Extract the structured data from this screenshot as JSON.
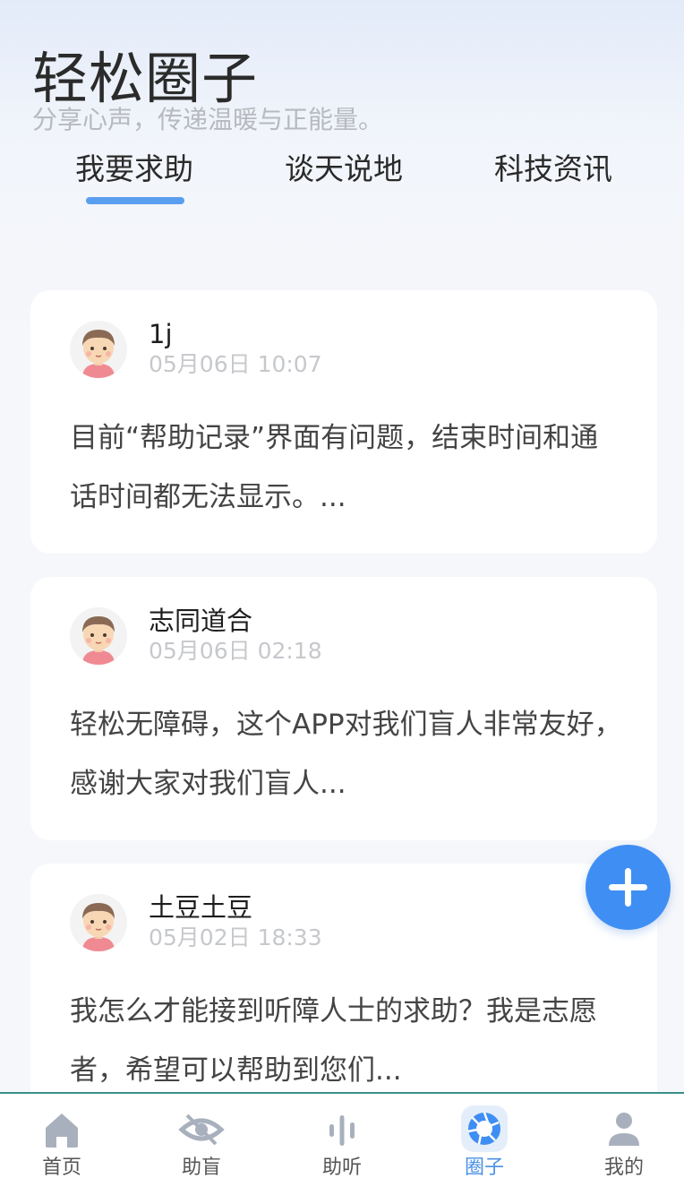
{
  "header": {
    "title": "轻松圈子",
    "subtitle": "分享心声，传递温暖与正能量。"
  },
  "tabs": [
    {
      "label": "我要求助",
      "active": true
    },
    {
      "label": "谈天说地",
      "active": false
    },
    {
      "label": "科技资讯",
      "active": false
    }
  ],
  "posts": [
    {
      "author": "1j",
      "time": "05月06日 10:07",
      "body": "目前“帮助记录”界面有问题，结束时间和通话时间都无法显示。..."
    },
    {
      "author": "志同道合",
      "time": "05月06日 02:18",
      "body": "轻松无障碍，这个APP对我们盲人非常友好，感谢大家对我们盲人..."
    },
    {
      "author": "土豆土豆",
      "time": "05月02日 18:33",
      "body": "我怎么才能接到听障人士的求助？我是志愿者，希望可以帮助到您们..."
    }
  ],
  "fab": {
    "icon": "plus-icon"
  },
  "nav": [
    {
      "label": "首页",
      "icon": "home-icon",
      "active": false
    },
    {
      "label": "助盲",
      "icon": "eye-icon",
      "active": false
    },
    {
      "label": "助听",
      "icon": "audio-wave-icon",
      "active": false
    },
    {
      "label": "圈子",
      "icon": "aperture-icon",
      "active": true
    },
    {
      "label": "我的",
      "icon": "user-icon",
      "active": false
    }
  ],
  "colors": {
    "accent": "#3f8ef3",
    "tab_indicator": "#5a9ef0",
    "nav_active": "#4a90e6",
    "nav_inactive_icon": "#a9b0bd"
  }
}
